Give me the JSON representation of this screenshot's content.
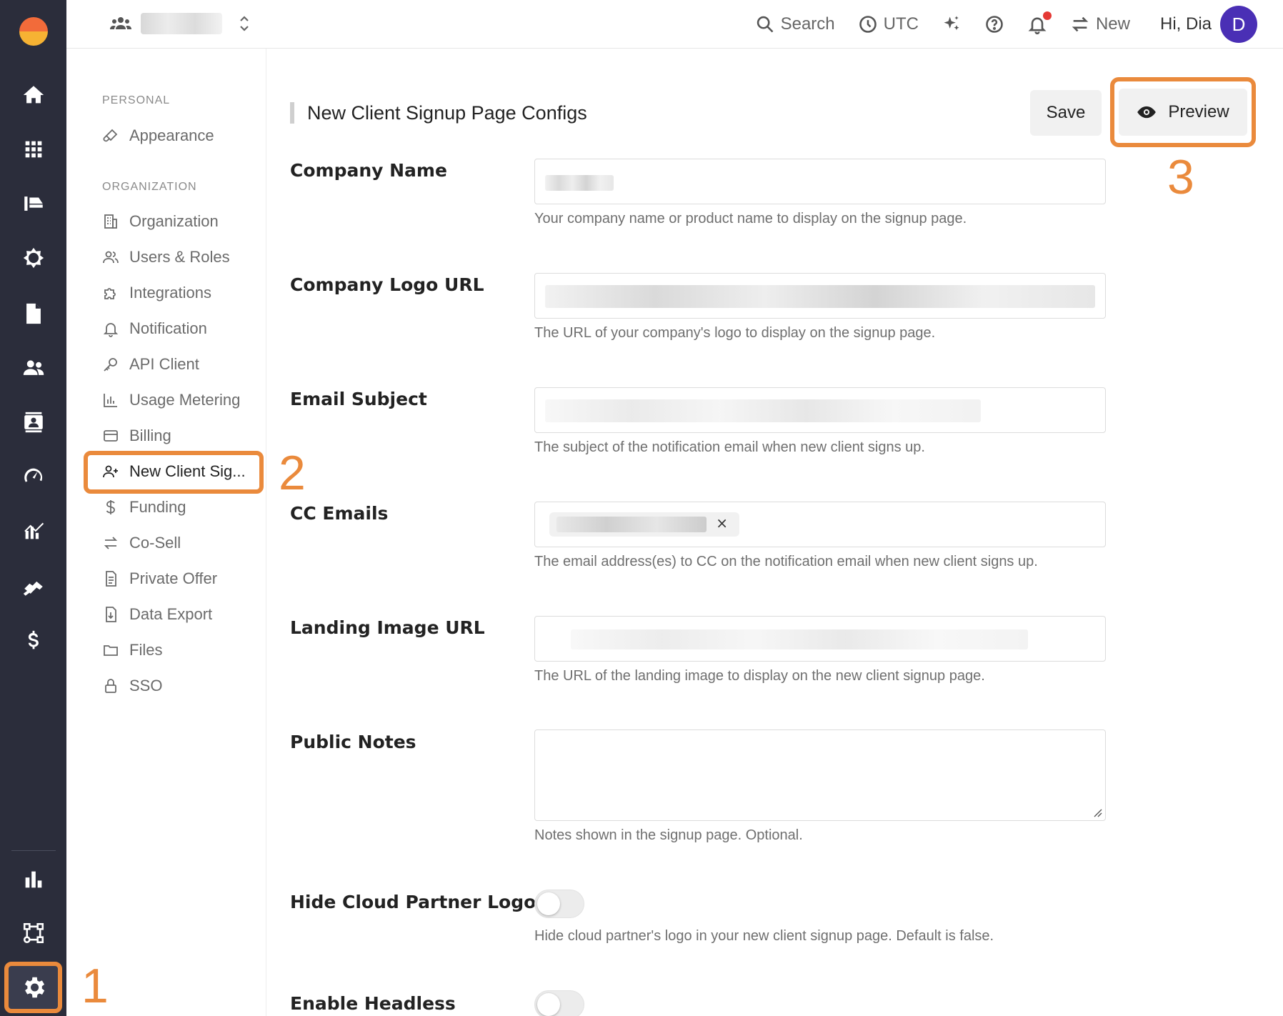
{
  "topbar": {
    "search_label": "Search",
    "timezone_label": "UTC",
    "new_label": "New",
    "greeting": "Hi, Dia",
    "avatar_initial": "D"
  },
  "settings_nav": {
    "personal_heading": "PERSONAL",
    "organization_heading": "ORGANIZATION",
    "personal_items": [
      {
        "label": "Appearance",
        "icon": "brush-icon"
      }
    ],
    "organization_items": [
      {
        "label": "Organization",
        "icon": "building-icon"
      },
      {
        "label": "Users & Roles",
        "icon": "users-icon"
      },
      {
        "label": "Integrations",
        "icon": "puzzle-icon"
      },
      {
        "label": "Notification",
        "icon": "bell-icon"
      },
      {
        "label": "API Client",
        "icon": "key-icon"
      },
      {
        "label": "Usage Metering",
        "icon": "bar-chart-icon"
      },
      {
        "label": "Billing",
        "icon": "credit-card-icon"
      },
      {
        "label": "New Client Sig...",
        "icon": "user-plus-icon",
        "active": true
      },
      {
        "label": "Funding",
        "icon": "dollar-icon"
      },
      {
        "label": "Co-Sell",
        "icon": "swap-icon"
      },
      {
        "label": "Private Offer",
        "icon": "document-icon"
      },
      {
        "label": "Data Export",
        "icon": "file-export-icon"
      },
      {
        "label": "Files",
        "icon": "folder-icon"
      },
      {
        "label": "SSO",
        "icon": "lock-icon"
      }
    ]
  },
  "callouts": [
    "1",
    "2",
    "3"
  ],
  "page": {
    "title": "New Client Signup Page Configs",
    "save_label": "Save",
    "preview_label": "Preview"
  },
  "form": {
    "company_name": {
      "label": "Company Name",
      "help": "Your company name or product name to display on the signup page."
    },
    "company_logo_url": {
      "label": "Company Logo URL",
      "help": "The URL of your company's logo to display on the signup page."
    },
    "email_subject": {
      "label": "Email Subject",
      "help": "The subject of the notification email when new client signs up."
    },
    "cc_emails": {
      "label": "CC Emails",
      "help": "The email address(es) to CC on the notification email when new client signs up.",
      "chip_remove": "×"
    },
    "landing_image_url": {
      "label": "Landing Image URL",
      "help": "The URL of the landing image to display on the new client signup page."
    },
    "public_notes": {
      "label": "Public Notes",
      "help": "Notes shown in the signup page. Optional."
    },
    "hide_cloud_partner_logo": {
      "label": "Hide Cloud Partner Logo",
      "help": "Hide cloud partner's logo in your new client signup page. Default is false.",
      "enabled": false
    },
    "enable_headless": {
      "label": "Enable Headless",
      "enabled": false
    }
  },
  "colors": {
    "rail_bg": "#2b2d3b",
    "accent_callout": "#ea8a3c",
    "avatar_bg": "#4a2fb5",
    "notification_dot": "#e53935"
  }
}
